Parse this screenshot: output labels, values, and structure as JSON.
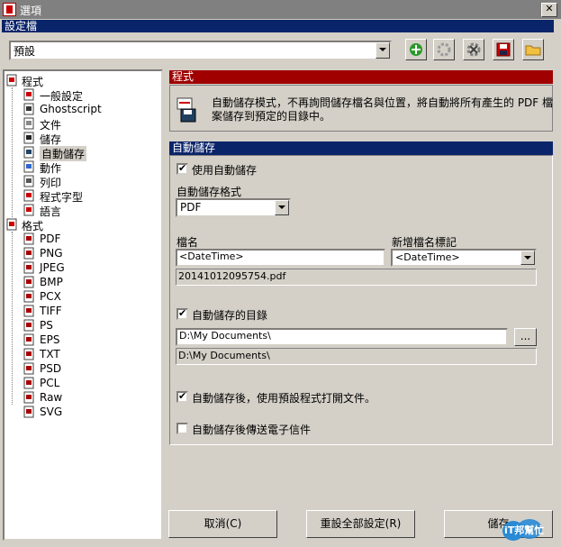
{
  "window": {
    "title": "選項"
  },
  "profile": {
    "header": "設定檔",
    "selected": "預設"
  },
  "tree": {
    "items": [
      {
        "label": "程式",
        "icon": "program-folder-icon"
      },
      {
        "label": "一般設定",
        "icon": "general-settings-icon"
      },
      {
        "label": "Ghostscript",
        "icon": "ghostscript-icon"
      },
      {
        "label": "文件",
        "icon": "document-icon"
      },
      {
        "label": "儲存",
        "icon": "save-icon"
      },
      {
        "label": "自動儲存",
        "icon": "autosave-icon"
      },
      {
        "label": "動作",
        "icon": "action-icon"
      },
      {
        "label": "列印",
        "icon": "print-icon"
      },
      {
        "label": "程式字型",
        "icon": "font-icon"
      },
      {
        "label": "語言",
        "icon": "language-flag-icon"
      },
      {
        "label": "格式",
        "icon": "format-folder-icon"
      },
      {
        "label": "PDF",
        "icon": "pdf-file-icon"
      },
      {
        "label": "PNG",
        "icon": "png-file-icon"
      },
      {
        "label": "JPEG",
        "icon": "jpeg-file-icon"
      },
      {
        "label": "BMP",
        "icon": "bmp-file-icon"
      },
      {
        "label": "PCX",
        "icon": "pcx-file-icon"
      },
      {
        "label": "TIFF",
        "icon": "tiff-file-icon"
      },
      {
        "label": "PS",
        "icon": "ps-file-icon"
      },
      {
        "label": "EPS",
        "icon": "eps-file-icon"
      },
      {
        "label": "TXT",
        "icon": "txt-file-icon"
      },
      {
        "label": "PSD",
        "icon": "psd-file-icon"
      },
      {
        "label": "PCL",
        "icon": "pcl-file-icon"
      },
      {
        "label": "Raw",
        "icon": "raw-file-icon"
      },
      {
        "label": "SVG",
        "icon": "svg-file-icon"
      }
    ]
  },
  "program_section": {
    "header": "程式",
    "description_line1": "自動儲存模式，不再詢問儲存檔名與位置，將自動將所有產生的 PDF 檔",
    "description_line2": "案儲存到預定的目錄中。"
  },
  "autosave": {
    "header": "自動儲存",
    "use_autosave_label": "使用自動儲存",
    "use_autosave_checked": true,
    "format_label": "自動儲存格式",
    "format_value": "PDF",
    "filename_label": "檔名",
    "filename_value": "<DateTime>",
    "add_token_label": "新增檔名標記",
    "add_token_value": "<DateTime>",
    "filename_preview": "20141012095754.pdf",
    "dir_label": "自動儲存的目錄",
    "dir_checked": true,
    "dir_value": "D:\\My Documents\\",
    "browse_label": "...",
    "dir_preview": "D:\\My Documents\\",
    "open_after_label": "自動儲存後，使用預設程式打開文件。",
    "open_after_checked": true,
    "email_label": "自動儲存後傳送電子信件",
    "email_checked": false
  },
  "buttons": {
    "cancel": "取消(C)",
    "reset_all": "重設全部設定(R)",
    "save": "儲存"
  },
  "watermark": {
    "text": "iT邦幫忙"
  },
  "colors": {
    "header_blue": "#0a246a",
    "header_red": "#a00000",
    "face": "#d4d0c8"
  }
}
